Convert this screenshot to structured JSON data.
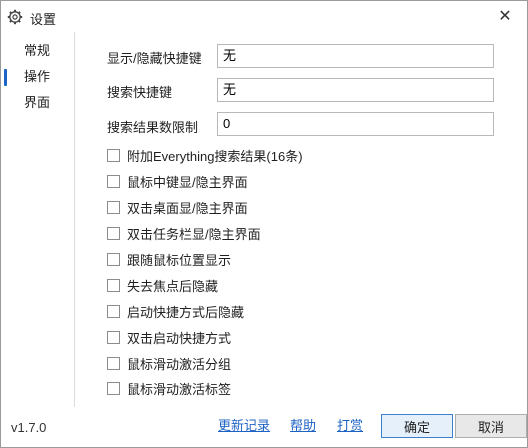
{
  "window": {
    "title": "设置",
    "close_glyph": "✕"
  },
  "sidebar": {
    "items": [
      {
        "label": "常规",
        "active": false
      },
      {
        "label": "操作",
        "active": true
      },
      {
        "label": "界面",
        "active": false
      }
    ]
  },
  "settings": {
    "toggle_hotkey": {
      "label": "显示/隐藏快捷键",
      "value": "无"
    },
    "search_hotkey": {
      "label": "搜索快捷键",
      "value": "无"
    },
    "result_limit": {
      "label": "搜索结果数限制",
      "value": "0"
    },
    "options": [
      {
        "label": "附加Everything搜索结果(16条)",
        "checked": false
      },
      {
        "label": "鼠标中键显/隐主界面",
        "checked": false
      },
      {
        "label": "双击桌面显/隐主界面",
        "checked": false
      },
      {
        "label": "双击任务栏显/隐主界面",
        "checked": false
      },
      {
        "label": "跟随鼠标位置显示",
        "checked": false
      },
      {
        "label": "失去焦点后隐藏",
        "checked": false
      },
      {
        "label": "启动快捷方式后隐藏",
        "checked": false
      },
      {
        "label": "双击启动快捷方式",
        "checked": false
      },
      {
        "label": "鼠标滑动激活分组",
        "checked": false
      },
      {
        "label": "鼠标滑动激活标签",
        "checked": false
      }
    ]
  },
  "footer": {
    "version": "v1.7.0",
    "links": {
      "changelog": "更新记录",
      "help": "帮助",
      "donate": "打赏"
    },
    "ok_label": "确定",
    "cancel_label": "取消"
  },
  "colors": {
    "accent": "#1d63c4",
    "border": "#b8b8b8"
  }
}
